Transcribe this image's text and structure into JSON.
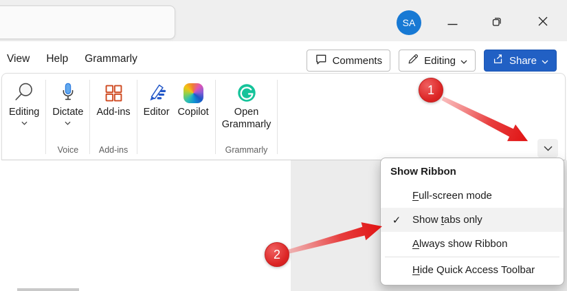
{
  "window": {
    "avatar_initials": "SA"
  },
  "menubar": {
    "tabs": [
      "View",
      "Help",
      "Grammarly"
    ],
    "comments_label": "Comments",
    "editing_label": "Editing",
    "share_label": "Share"
  },
  "ribbon": {
    "editing": {
      "label": "Editing"
    },
    "dictate": {
      "label": "Dictate"
    },
    "addins": {
      "label": "Add-ins"
    },
    "editor": {
      "label": "Editor"
    },
    "copilot": {
      "label": "Copilot"
    },
    "grammarly": {
      "line1": "Open",
      "line2": "Grammarly"
    },
    "groups": {
      "voice": "Voice",
      "addins": "Add-ins",
      "grammarly": "Grammarly"
    }
  },
  "dropdown": {
    "title": "Show Ribbon",
    "items": [
      {
        "label": "Full-screen mode",
        "accel_index": 0,
        "checked": false
      },
      {
        "label": "Show tabs only",
        "accel_index": 5,
        "checked": true
      },
      {
        "label": "Always show Ribbon",
        "accel_index": 0,
        "checked": false
      },
      {
        "label": "Hide Quick Access Toolbar",
        "accel_index": 0,
        "checked": false
      }
    ]
  },
  "annotations": {
    "step1": "1",
    "step2": "2"
  },
  "icons": {
    "check": "✓"
  },
  "colors": {
    "share_button_blue": "#2160c4",
    "avatar_blue": "#1779d4",
    "grammarly_green": "#15c39a",
    "addins_orange": "#cf4a21",
    "dictate_blue": "#62a9ee",
    "editor_blue": "#2458c8",
    "annotation_red": "#dc2424",
    "titlebar_gray": "#efefef",
    "document_side_gray": "#ececec",
    "menu_highlight": "#f2f2f2"
  }
}
